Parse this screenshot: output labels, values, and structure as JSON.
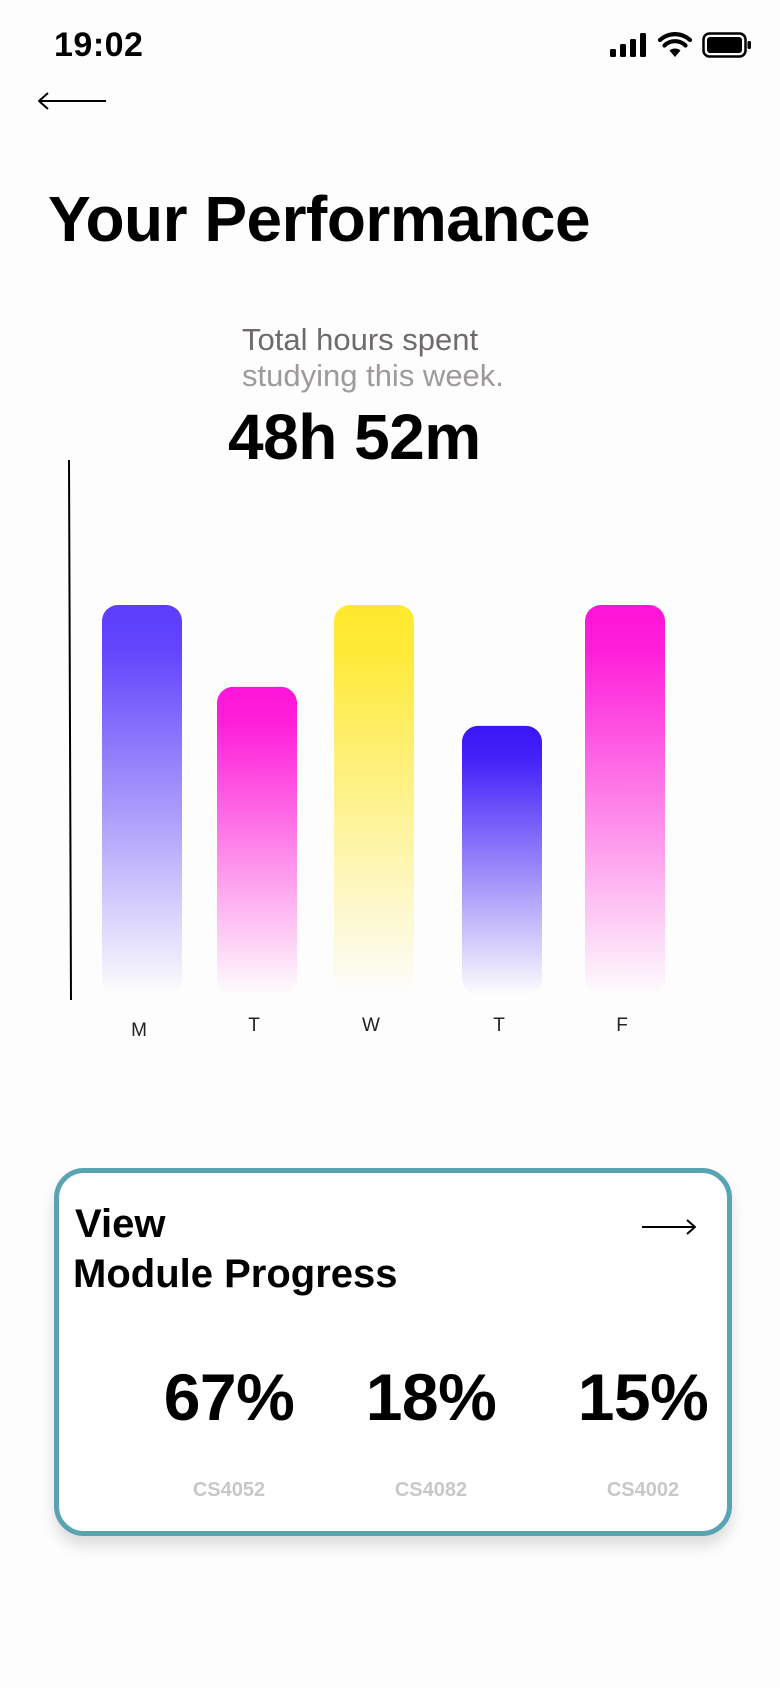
{
  "status_bar": {
    "time": "19:02"
  },
  "page": {
    "title": "Your Performance",
    "subtitle_line1": "Total hours spent",
    "subtitle_line2": "studying this week.",
    "total_hours": "48h 52m"
  },
  "chart_data": {
    "type": "bar",
    "categories": [
      "M",
      "T",
      "W",
      "T",
      "F"
    ],
    "values": [
      10,
      7.9,
      10,
      6.9,
      10
    ],
    "colors": [
      "#5b3dfc",
      "#ff14d8",
      "#ffe92e",
      "#3a16f7",
      "#ff14d8"
    ],
    "title": "",
    "xlabel": "",
    "ylabel": "",
    "grid": false
  },
  "module_card": {
    "title_line1": "View",
    "title_line2": "Module Progress",
    "modules": [
      {
        "percent": "67%",
        "code": "CS4052"
      },
      {
        "percent": "18%",
        "code": "CS4082"
      },
      {
        "percent": "15%",
        "code": "CS4002"
      }
    ]
  },
  "accent": {
    "card_border": "#5aa3b3"
  }
}
